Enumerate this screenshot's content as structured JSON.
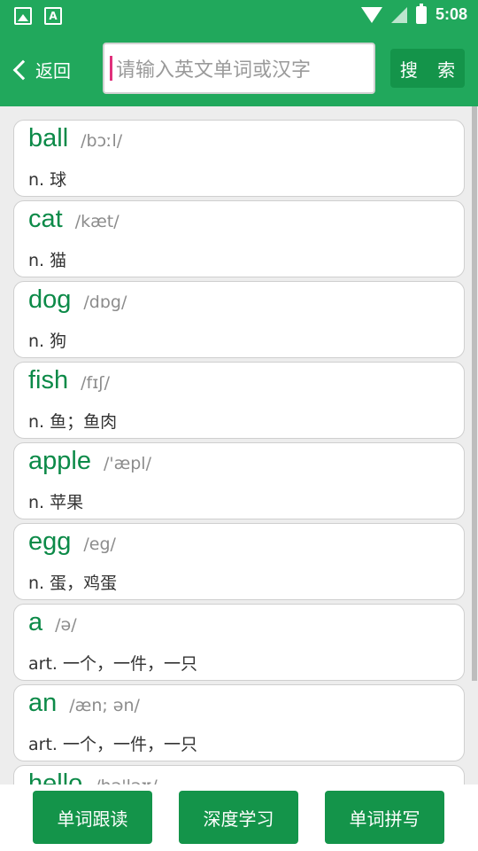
{
  "status": {
    "time": "5:08",
    "icons": [
      "image-icon",
      "font-icon",
      "wifi-icon",
      "signal-icon",
      "battery-icon"
    ]
  },
  "header": {
    "back_label": "返回",
    "search_placeholder": "请输入英文单词或汉字",
    "search_button": "搜 索"
  },
  "words": [
    {
      "word": "ball",
      "phonetic": "/bɔːl/",
      "definition": "n. 球"
    },
    {
      "word": "cat",
      "phonetic": "/kæt/",
      "definition": "n. 猫"
    },
    {
      "word": "dog",
      "phonetic": "/dɒg/",
      "definition": "n. 狗"
    },
    {
      "word": "fish",
      "phonetic": "/fɪʃ/",
      "definition": "n. 鱼；鱼肉"
    },
    {
      "word": "apple",
      "phonetic": "/'æpl/",
      "definition": "n. 苹果"
    },
    {
      "word": "egg",
      "phonetic": "/eg/",
      "definition": "n. 蛋，鸡蛋"
    },
    {
      "word": "a",
      "phonetic": "/ə/",
      "definition": "art. 一个，一件，一只"
    },
    {
      "word": "an",
      "phonetic": "/æn; ən/",
      "definition": "art. 一个，一件，一只"
    },
    {
      "word": "hello",
      "phonetic": "/hə'ləʊ/",
      "definition": ""
    }
  ],
  "bottom": {
    "follow_read": "单词跟读",
    "deep_study": "深度学习",
    "spelling": "单词拼写"
  },
  "colors": {
    "primary": "#21a85c",
    "button": "#14944a",
    "word": "#0c8a48"
  }
}
